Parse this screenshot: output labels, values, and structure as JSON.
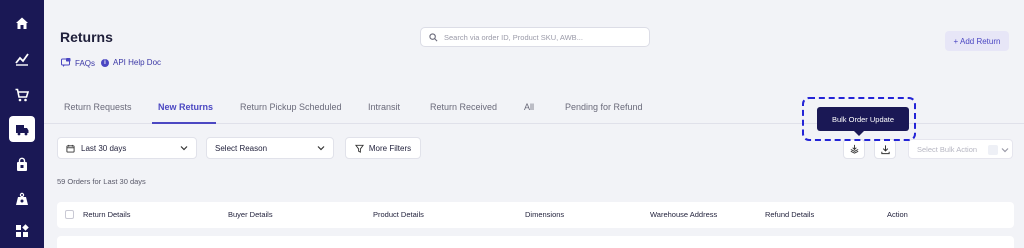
{
  "sidebar": {
    "items": [
      {
        "icon": "home-icon",
        "active": false
      },
      {
        "icon": "analytics-icon",
        "active": false
      },
      {
        "icon": "cart-icon",
        "active": false
      },
      {
        "icon": "returns-icon",
        "active": true
      },
      {
        "icon": "bag-icon",
        "active": false
      },
      {
        "icon": "weight-icon",
        "active": false
      },
      {
        "icon": "apps-icon",
        "active": false
      }
    ]
  },
  "header": {
    "title": "Returns",
    "faqs_label": "FAQs",
    "api_help_label": "API Help Doc",
    "add_return_label": "+ Add Return"
  },
  "search": {
    "placeholder": "Search via order ID, Product SKU, AWB...",
    "value": ""
  },
  "tabs": [
    {
      "label": "Return Requests",
      "active": false
    },
    {
      "label": "New Returns",
      "active": true
    },
    {
      "label": "Return Pickup Scheduled",
      "active": false
    },
    {
      "label": "Intransit",
      "active": false
    },
    {
      "label": "Return Received",
      "active": false
    },
    {
      "label": "All",
      "active": false
    },
    {
      "label": "Pending for Refund",
      "active": false
    }
  ],
  "filters": {
    "date_range": "Last 30 days",
    "reason": "Select Reason",
    "more_filters": "More Filters",
    "bulk_action_placeholder": "Select Bulk Action"
  },
  "tooltip": {
    "text": "Bulk Order Update"
  },
  "orders_summary": "59 Orders for Last 30 days",
  "table": {
    "columns": [
      "Return Details",
      "Buyer Details",
      "Product Details",
      "Dimensions",
      "Warehouse Address",
      "Refund Details",
      "Action"
    ]
  },
  "colors": {
    "sidebar_bg": "#1a1855",
    "accent": "#4b47c2",
    "highlight_ring": "#2424d6",
    "page_bg": "#f2f3f7"
  }
}
